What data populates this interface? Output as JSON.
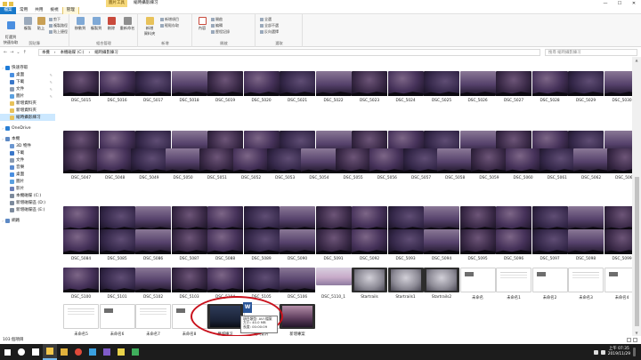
{
  "window": {
    "title": "縮時攝影練习",
    "context_tab": "圖片工具",
    "controls": [
      "—",
      "☐",
      "✕"
    ]
  },
  "ribbon_tabs": [
    {
      "label": "檔案",
      "kind": "file"
    },
    {
      "label": "常用",
      "kind": "normal"
    },
    {
      "label": "共用",
      "kind": "normal"
    },
    {
      "label": "檢視",
      "kind": "normal"
    },
    {
      "label": "管理",
      "kind": "active"
    }
  ],
  "ribbon": {
    "clipboard": {
      "label": "剪貼簿",
      "pin": "釘選到\n快速存取",
      "copy": "複製",
      "paste": "貼上",
      "cut": "剪下",
      "copy_path": "複製路徑",
      "paste_shortcut": "貼上捷徑"
    },
    "organize": {
      "label": "組合管理",
      "move_to": "移動到",
      "copy_to": "複製到",
      "delete": "刪除",
      "rename": "重新命名"
    },
    "new": {
      "label": "新增",
      "new_folder": "新增\n資料夾",
      "new_item": "新增項目",
      "easy_access": "輕鬆存取"
    },
    "open": {
      "label": "開啟",
      "properties": "內容",
      "open": "開啟",
      "edit": "編輯",
      "history": "歷程記錄"
    },
    "select": {
      "label": "選取",
      "select_all": "全選",
      "select_none": "全部不選",
      "invert": "反向選擇"
    }
  },
  "address": {
    "path": [
      "本機",
      "本機磁碟 (C:)",
      "縮時攝影練习"
    ],
    "search_placeholder": "搜尋 縮時攝影練习"
  },
  "sidebar": {
    "items": [
      {
        "label": "快速存取",
        "level": 0,
        "color": "#1e7cd8",
        "pin": false,
        "sel": false,
        "sp": false
      },
      {
        "label": "桌面",
        "level": 1,
        "color": "#4a8fe0",
        "pin": true,
        "sel": false,
        "sp": false
      },
      {
        "label": "下載",
        "level": 1,
        "color": "#3a77c9",
        "pin": true,
        "sel": false,
        "sp": false
      },
      {
        "label": "文件",
        "level": 1,
        "color": "#8a9ab0",
        "pin": true,
        "sel": false,
        "sp": false
      },
      {
        "label": "圖片",
        "level": 1,
        "color": "#5aa0e0",
        "pin": true,
        "sel": false,
        "sp": false
      },
      {
        "label": "新增資料夾",
        "level": 1,
        "color": "#e8c25a",
        "pin": false,
        "sel": false,
        "sp": false
      },
      {
        "label": "新增資料夾",
        "level": 1,
        "color": "#e8c25a",
        "pin": false,
        "sel": false,
        "sp": false
      },
      {
        "label": "縮時攝影練习",
        "level": 1,
        "color": "#e8c25a",
        "pin": false,
        "sel": true,
        "sp": false
      },
      {
        "label": "OneDrive",
        "level": 0,
        "color": "#2a7fd4",
        "pin": false,
        "sel": false,
        "sp": true
      },
      {
        "label": "本機",
        "level": 0,
        "color": "#5d89c4",
        "pin": false,
        "sel": false,
        "sp": true
      },
      {
        "label": "3D 物件",
        "level": 1,
        "color": "#6a96d0",
        "pin": false,
        "sel": false,
        "sp": false
      },
      {
        "label": "下載",
        "level": 1,
        "color": "#3a77c9",
        "pin": false,
        "sel": false,
        "sp": false
      },
      {
        "label": "文件",
        "level": 1,
        "color": "#8a9ab0",
        "pin": false,
        "sel": false,
        "sp": false
      },
      {
        "label": "音樂",
        "level": 1,
        "color": "#5b8bd0",
        "pin": false,
        "sel": false,
        "sp": false
      },
      {
        "label": "桌面",
        "level": 1,
        "color": "#4a8fe0",
        "pin": false,
        "sel": false,
        "sp": false
      },
      {
        "label": "圖片",
        "level": 1,
        "color": "#5aa0e0",
        "pin": false,
        "sel": false,
        "sp": false
      },
      {
        "label": "影片",
        "level": 1,
        "color": "#6a7fb8",
        "pin": false,
        "sel": false,
        "sp": false
      },
      {
        "label": "本機磁碟 (C:)",
        "level": 1,
        "color": "#7c8a9c",
        "pin": false,
        "sel": false,
        "sp": false
      },
      {
        "label": "新增磁碟區 (D:)",
        "level": 1,
        "color": "#7c8a9c",
        "pin": false,
        "sel": false,
        "sp": false
      },
      {
        "label": "新增磁碟區 (E:)",
        "level": 1,
        "color": "#7c8a9c",
        "pin": false,
        "sel": false,
        "sp": false
      },
      {
        "label": "網路",
        "level": 0,
        "color": "#5d89c4",
        "pin": false,
        "sel": false,
        "sp": true
      }
    ]
  },
  "files": [
    {
      "name": "DSC_5015",
      "kind": "photo"
    },
    {
      "name": "DSC_5016",
      "kind": "photo"
    },
    {
      "name": "DSC_5017",
      "kind": "photo"
    },
    {
      "name": "DSC_5018",
      "kind": "photo"
    },
    {
      "name": "DSC_5019",
      "kind": "photo"
    },
    {
      "name": "DSC_5020",
      "kind": "photo"
    },
    {
      "name": "DSC_5021",
      "kind": "photo"
    },
    {
      "name": "DSC_5022",
      "kind": "photo"
    },
    {
      "name": "DSC_5023",
      "kind": "photo"
    },
    {
      "name": "DSC_5024",
      "kind": "photo"
    },
    {
      "name": "DSC_5025",
      "kind": "photo"
    },
    {
      "name": "DSC_5026",
      "kind": "photo"
    },
    {
      "name": "DSC_5027",
      "kind": "photo"
    },
    {
      "name": "DSC_5028",
      "kind": "photo"
    },
    {
      "name": "DSC_5029",
      "kind": "photo"
    },
    {
      "name": "DSC_5030",
      "kind": "photo"
    },
    {
      "name": "DSC_5031",
      "kind": "photo"
    },
    {
      "name": "DSC_5032",
      "kind": "photo"
    },
    {
      "name": "DSC_5033",
      "kind": "photo"
    },
    {
      "name": "DSC_5034",
      "kind": "photo"
    },
    {
      "name": "DSC_5035",
      "kind": "photo"
    },
    {
      "name": "DSC_5036",
      "kind": "photo"
    },
    {
      "name": "DSC_5037",
      "kind": "photo"
    },
    {
      "name": "DSC_5038",
      "kind": "photo"
    },
    {
      "name": "DSC_5039",
      "kind": "photo"
    },
    {
      "name": "DSC_5040",
      "kind": "photo"
    },
    {
      "name": "DSC_5041",
      "kind": "photo"
    },
    {
      "name": "DSC_5042",
      "kind": "photo"
    },
    {
      "name": "DSC_5043",
      "kind": "photo"
    },
    {
      "name": "DSC_5044",
      "kind": "photo"
    },
    {
      "name": "DSC_5045",
      "kind": "photo"
    },
    {
      "name": "DSC_5046",
      "kind": "photo"
    },
    {
      "name": "DSC_5047",
      "kind": "photo"
    },
    {
      "name": "DSC_5048",
      "kind": "photo"
    },
    {
      "name": "DSC_5049",
      "kind": "photo"
    },
    {
      "name": "DSC_5050",
      "kind": "photo"
    },
    {
      "name": "DSC_5051",
      "kind": "photo"
    },
    {
      "name": "DSC_5052",
      "kind": "photo"
    },
    {
      "name": "DSC_5053",
      "kind": "photo"
    },
    {
      "name": "DSC_5054",
      "kind": "photo"
    },
    {
      "name": "DSC_5055",
      "kind": "photo"
    },
    {
      "name": "DSC_5056",
      "kind": "photo"
    },
    {
      "name": "DSC_5057",
      "kind": "photo"
    },
    {
      "name": "DSC_5058",
      "kind": "photo"
    },
    {
      "name": "DSC_5059",
      "kind": "photo"
    },
    {
      "name": "DSC_5060",
      "kind": "photo"
    },
    {
      "name": "DSC_5061",
      "kind": "photo"
    },
    {
      "name": "DSC_5062",
      "kind": "photo"
    },
    {
      "name": "DSC_5063",
      "kind": "photo"
    },
    {
      "name": "DSC_5068",
      "kind": "photo"
    },
    {
      "name": "DSC_5069",
      "kind": "photo"
    },
    {
      "name": "DSC_5070",
      "kind": "photo"
    },
    {
      "name": "DSC_5071",
      "kind": "photo"
    },
    {
      "name": "DSC_5072",
      "kind": "photo"
    },
    {
      "name": "DSC_5073",
      "kind": "photo"
    },
    {
      "name": "DSC_5074",
      "kind": "photo"
    },
    {
      "name": "DSC_5075",
      "kind": "photo"
    },
    {
      "name": "DSC_5076",
      "kind": "photo"
    },
    {
      "name": "DSC_5077",
      "kind": "photo"
    },
    {
      "name": "DSC_5078",
      "kind": "photo"
    },
    {
      "name": "DSC_5079",
      "kind": "photo"
    },
    {
      "name": "DSC_5080",
      "kind": "photo"
    },
    {
      "name": "DSC_5081",
      "kind": "photo"
    },
    {
      "name": "DSC_5082",
      "kind": "photo"
    },
    {
      "name": "DSC_5083",
      "kind": "photo"
    },
    {
      "name": "DSC_5084",
      "kind": "photo"
    },
    {
      "name": "DSC_5085",
      "kind": "photo"
    },
    {
      "name": "DSC_5086",
      "kind": "photo"
    },
    {
      "name": "DSC_5087",
      "kind": "photo"
    },
    {
      "name": "DSC_5088",
      "kind": "photo"
    },
    {
      "name": "DSC_5089",
      "kind": "photo"
    },
    {
      "name": "DSC_5090",
      "kind": "photo"
    },
    {
      "name": "DSC_5091",
      "kind": "photo"
    },
    {
      "name": "DSC_5092",
      "kind": "photo"
    },
    {
      "name": "DSC_5093",
      "kind": "photo"
    },
    {
      "name": "DSC_5094",
      "kind": "photo"
    },
    {
      "name": "DSC_5095",
      "kind": "photo"
    },
    {
      "name": "DSC_5096",
      "kind": "photo"
    },
    {
      "name": "DSC_5097",
      "kind": "photo"
    },
    {
      "name": "DSC_5098",
      "kind": "photo"
    },
    {
      "name": "DSC_5099",
      "kind": "photo"
    },
    {
      "name": "DSC_5100",
      "kind": "photo"
    },
    {
      "name": "DSC_5101",
      "kind": "photo"
    },
    {
      "name": "DSC_5102",
      "kind": "photo"
    },
    {
      "name": "DSC_5103",
      "kind": "photo"
    },
    {
      "name": "DSC_5104",
      "kind": "photo"
    },
    {
      "name": "DSC_5105",
      "kind": "photo"
    },
    {
      "name": "DSC_5106",
      "kind": "photo"
    },
    {
      "name": "DSC_5110_1",
      "kind": "pano"
    },
    {
      "name": "Startrails",
      "kind": "film"
    },
    {
      "name": "Startrails1",
      "kind": "film"
    },
    {
      "name": "Startrails2",
      "kind": "film"
    },
    {
      "name": "未命名",
      "kind": "doc"
    },
    {
      "name": "未命名1",
      "kind": "doc"
    },
    {
      "name": "未命名2",
      "kind": "doc"
    },
    {
      "name": "未命名3",
      "kind": "doc"
    },
    {
      "name": "未命名4",
      "kind": "doc"
    },
    {
      "name": "未命名5",
      "kind": "doc"
    },
    {
      "name": "未命名6",
      "kind": "doc"
    },
    {
      "name": "未命名7",
      "kind": "doc"
    },
    {
      "name": "未命名8",
      "kind": "doc"
    },
    {
      "name": "童城練习",
      "kind": "film-dark"
    },
    {
      "name": "縮時影片",
      "kind": "word"
    },
    {
      "name": "新增專案",
      "kind": "film-purple"
    }
  ],
  "tooltip": {
    "lines": [
      "項目類型: AVI 檔案",
      "大小: 40.0 MB",
      "長度: 00:00:09"
    ]
  },
  "status": {
    "count": "103 個項目"
  },
  "taskbar": {
    "icons": [
      {
        "name": "start",
        "color": "#ffffff"
      },
      {
        "name": "search",
        "color": "#ffffff"
      },
      {
        "name": "task-view",
        "color": "#ffffff"
      },
      {
        "name": "explorer",
        "color": "#f3c64a"
      },
      {
        "name": "folder",
        "color": "#e2b23c"
      },
      {
        "name": "chrome",
        "color": "#e04a3a"
      },
      {
        "name": "media",
        "color": "#3aa0e0"
      },
      {
        "name": "paint",
        "color": "#7f5bc8"
      },
      {
        "name": "app",
        "color": "#e8d24a"
      },
      {
        "name": "app2",
        "color": "#3fae5c"
      }
    ],
    "time": "上午 07:35",
    "date": "2019/11/29"
  }
}
